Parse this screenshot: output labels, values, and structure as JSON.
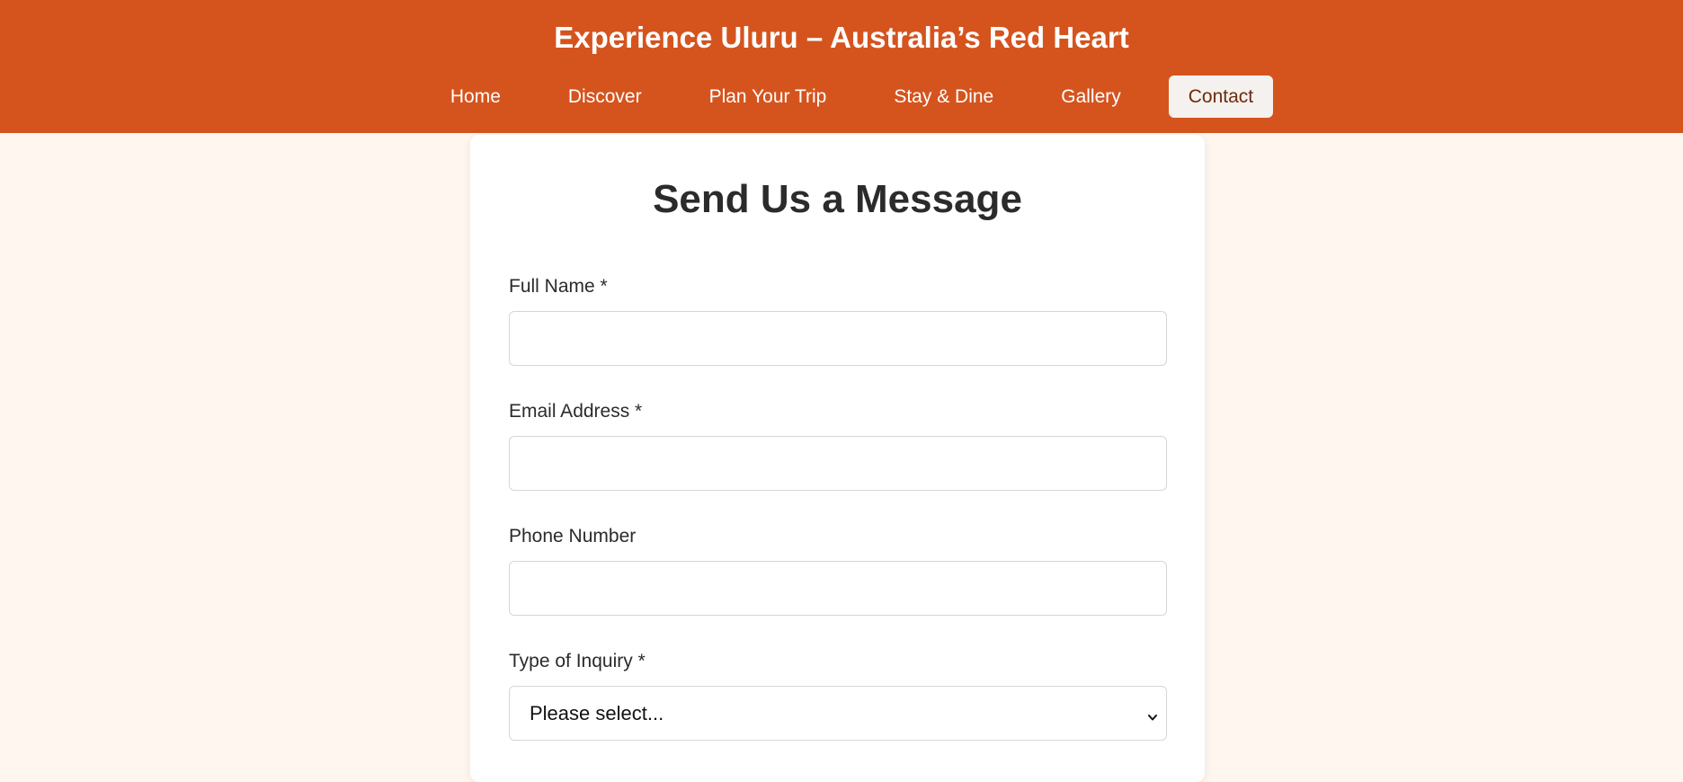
{
  "header": {
    "title": "Experience Uluru – Australia’s Red Heart",
    "nav": [
      {
        "label": "Home"
      },
      {
        "label": "Discover"
      },
      {
        "label": "Plan Your Trip"
      },
      {
        "label": "Stay & Dine"
      },
      {
        "label": "Gallery"
      },
      {
        "label": "Contact",
        "active": true
      }
    ]
  },
  "form": {
    "title": "Send Us a Message",
    "fields": {
      "full_name": {
        "label": "Full Name *",
        "value": ""
      },
      "email": {
        "label": "Email Address *",
        "value": ""
      },
      "phone": {
        "label": "Phone Number",
        "value": ""
      },
      "inquiry": {
        "label": "Type of Inquiry *",
        "selected": "Please select..."
      }
    }
  },
  "colors": {
    "header_bg": "#d5541e",
    "page_bg": "#fff6f0",
    "active_nav_bg": "#f5f1ee",
    "active_nav_text": "#6b2c0c"
  },
  "icons": {
    "select_arrow": "chevron-down-icon"
  }
}
